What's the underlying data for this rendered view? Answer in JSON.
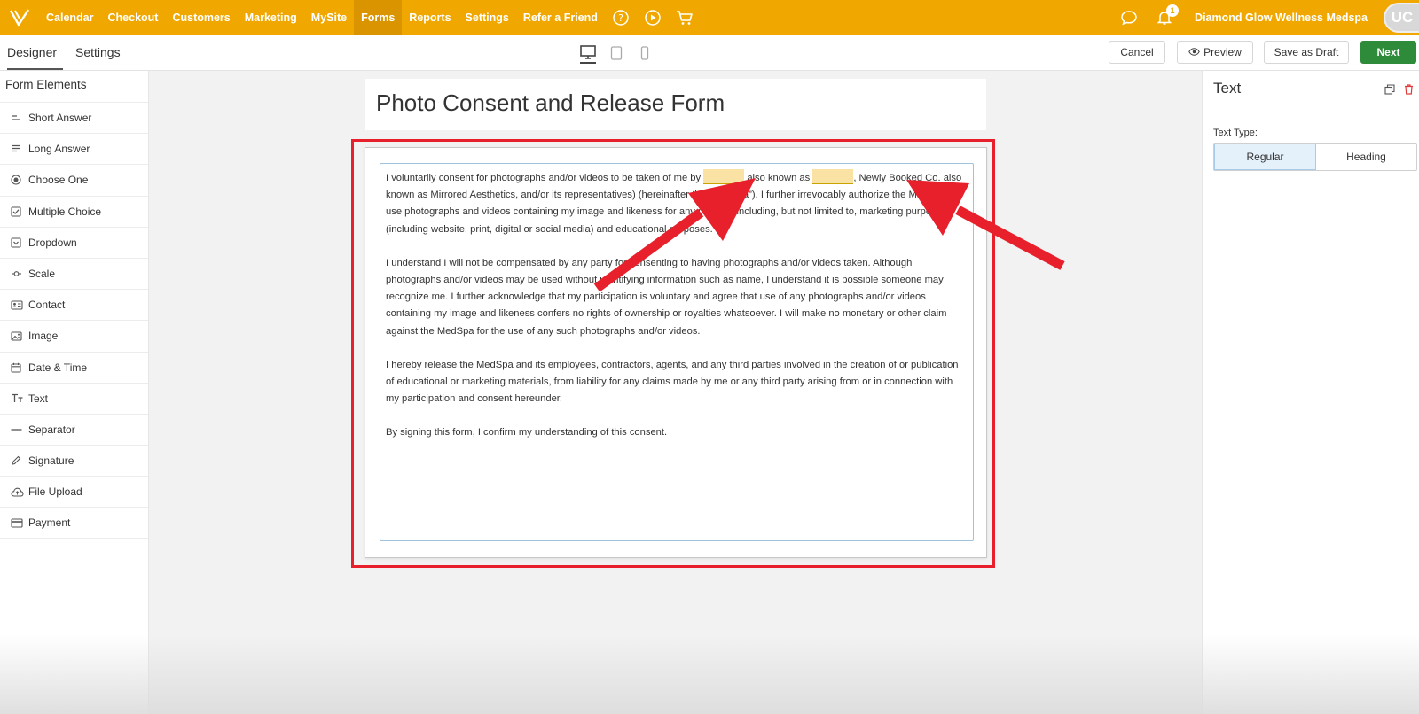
{
  "topnav": {
    "items": [
      "Calendar",
      "Checkout",
      "Customers",
      "Marketing",
      "MySite",
      "Forms",
      "Reports",
      "Settings",
      "Refer a Friend"
    ],
    "active_item": "Forms",
    "notification_count": "1",
    "business_name": "Diamond Glow Wellness Medspa",
    "avatar_initials": "UC"
  },
  "subheader": {
    "tabs": [
      "Designer",
      "Settings"
    ],
    "cancel_label": "Cancel",
    "preview_label": "Preview",
    "draft_label": "Save as Draft",
    "next_label": "Next"
  },
  "sidebar": {
    "title": "Form Elements",
    "items": [
      "Short Answer",
      "Long Answer",
      "Choose One",
      "Multiple Choice",
      "Dropdown",
      "Scale",
      "Contact",
      "Image",
      "Date & Time",
      "Text",
      "Separator",
      "Signature",
      "File Upload",
      "Payment"
    ]
  },
  "form": {
    "title": "Photo Consent and Release Form",
    "p1_a": "I voluntarily consent for photographs and/or videos to be taken of me by ",
    "p1_b": " also known as ",
    "p1_c": ", Newly Booked Co. also known as Mirrored Aesthetics, and/or its representatives) (hereinafter the “MedSpa”). I further irrevocably authorize the MedSpa to use photographs and videos containing my image and likeness for any purpose including, but not limited to, marketing purposes (including website, print, digital or social media) and educational purposes.",
    "p2": "I understand I will not be compensated by any party for consenting to having photographs and/or videos taken. Although photographs and/or videos may be used without identifying information such as name, I understand it is possible someone may recognize me. I further acknowledge that my participation is voluntary and agree that use of any photographs and/or videos containing my image and likeness confers no rights of ownership or royalties whatsoever. I will make no monetary or other claim against the MedSpa for the use of any such photographs and/or videos.",
    "p3": "I hereby release the MedSpa and its employees, contractors, agents, and any third parties involved in the creation of or publication of educational or marketing materials, from liability for any claims made by me or any third party arising from or in connection with my participation and consent hereunder.",
    "p4": "By signing this form, I confirm my understanding of this consent."
  },
  "right_panel": {
    "title": "Text",
    "text_type_label": "Text Type:",
    "options": [
      "Regular",
      "Heading"
    ],
    "selected": "Regular"
  },
  "colors": {
    "brand": "#f0a800",
    "next_button": "#2e8b3a",
    "highlight_frame": "#e8202b",
    "placeholder_fill": "#f9e2a3"
  }
}
